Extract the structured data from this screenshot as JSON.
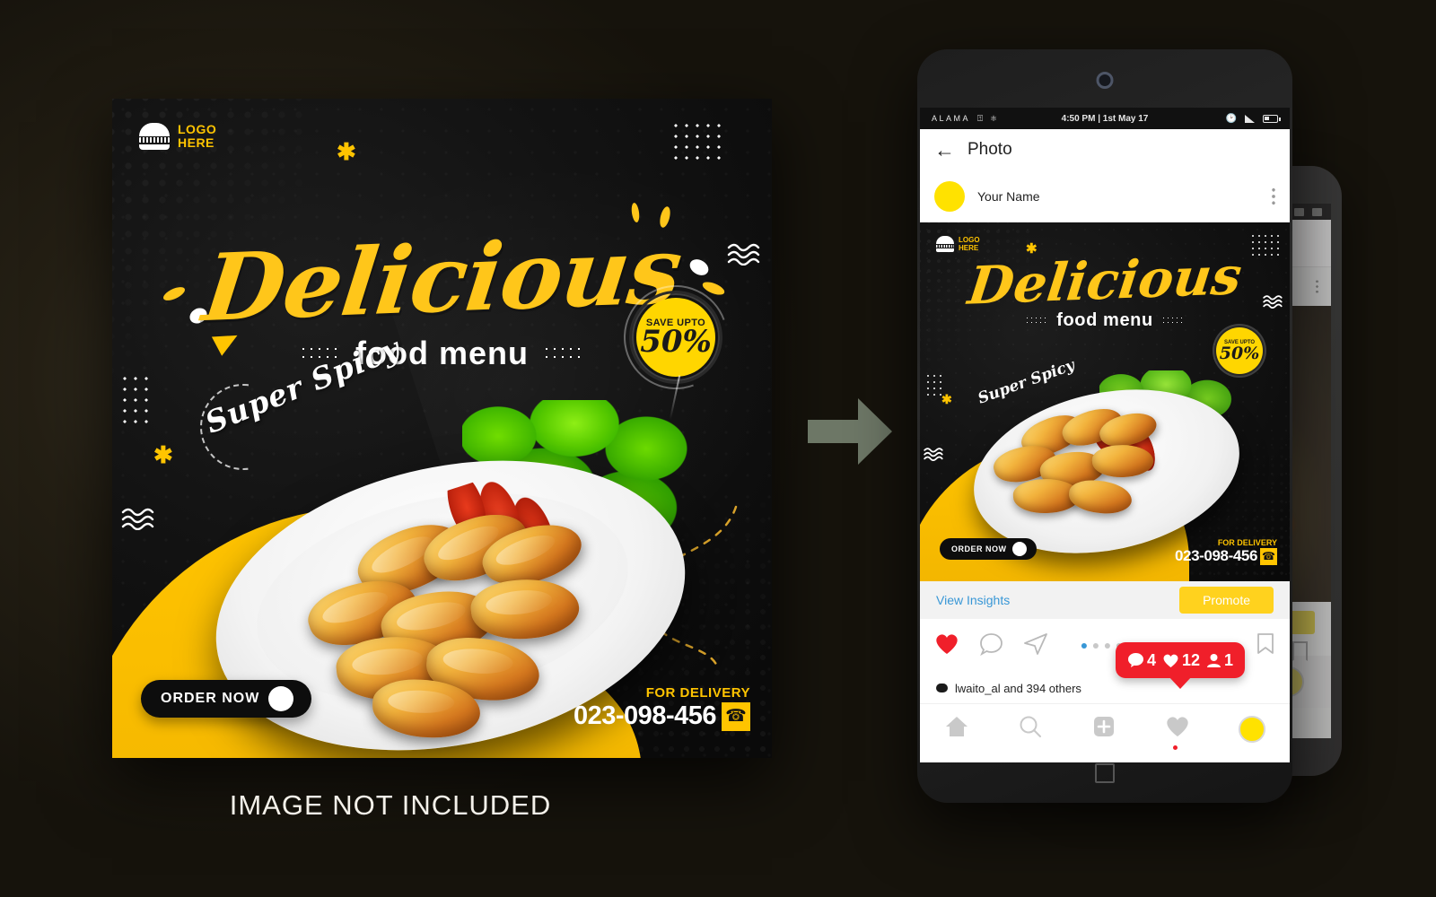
{
  "poster": {
    "logo_line1": "LOGO",
    "logo_line2": "HERE",
    "logo_icon": "burger-icon",
    "headline": "Delicious",
    "subheadline": "food menu",
    "spicy_label": "Super Spicy",
    "badge": {
      "top_text": "SAVE UPTO",
      "percent": "50%"
    },
    "order_button": "ORDER NOW",
    "order_arrow_icon": "arrow-right-icon",
    "delivery_label": "FOR DELIVERY",
    "delivery_phone": "023-098-456",
    "phone_icon": "phone-icon"
  },
  "caption": "IMAGE NOT INCLUDED",
  "phone": {
    "status_bar": {
      "carrier": "ALAMA",
      "wifi_icon": "wifi-icon",
      "bluetooth_icon": "bluetooth-icon",
      "time": "4:50 PM | 1st May 17",
      "clock_icon": "clock-icon",
      "signal_icon": "signal-icon",
      "battery_icon": "battery-icon"
    },
    "app_header": {
      "back_icon": "back-arrow-icon",
      "title": "Photo"
    },
    "post_user": {
      "avatar_icon": "avatar-icon",
      "name": "Your Name",
      "menu_icon": "kebab-menu-icon"
    },
    "insights": {
      "link": "View Insights",
      "promote_button": "Promote"
    },
    "actions": {
      "like_icon": "heart-icon",
      "comment_icon": "comment-icon",
      "share_icon": "send-icon",
      "save_icon": "bookmark-icon"
    },
    "notification_bubble": {
      "comments": "4",
      "likes": "12",
      "followers": "1",
      "comment_icon": "comment-bubble-icon",
      "heart_icon": "heart-icon",
      "person_icon": "person-icon"
    },
    "likes_text": "lwaito_al  and 394 others",
    "bottom_nav": {
      "home_icon": "home-icon",
      "search_icon": "search-icon",
      "add_icon": "plus-icon",
      "activity_icon": "heart-outline-icon",
      "profile_icon": "profile-avatar-icon"
    },
    "home_button_icon": "square-home-icon"
  },
  "arrow_icon": "arrow-right-big-icon",
  "colors": {
    "brand_yellow": "#FFC400",
    "badge_yellow": "#FFD600",
    "notification_red": "#F01F2A",
    "link_blue": "#3897d6",
    "poster_black": "#121212"
  }
}
